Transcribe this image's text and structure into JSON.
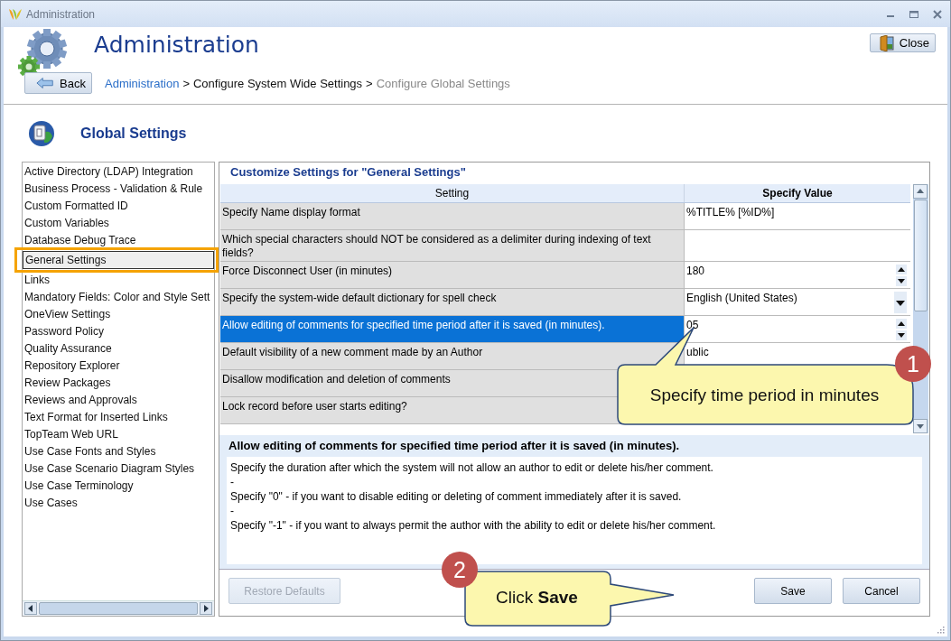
{
  "window": {
    "title": "Administration"
  },
  "header": {
    "title": "Administration",
    "close_button": "Close",
    "back_button": "Back",
    "breadcrumb": [
      {
        "label": "Administration",
        "kind": "link"
      },
      {
        "label": ">",
        "kind": "separator"
      },
      {
        "label": "Configure System Wide Settings",
        "kind": "current"
      },
      {
        "label": ">",
        "kind": "separator"
      },
      {
        "label": "Configure Global Settings",
        "kind": "muted"
      }
    ]
  },
  "section": {
    "title": "Global Settings"
  },
  "sidebar": {
    "items": [
      {
        "label": "Active Directory (LDAP) Integration",
        "selected": false
      },
      {
        "label": "Business Process - Validation & Rule",
        "selected": false
      },
      {
        "label": "Custom Formatted ID",
        "selected": false
      },
      {
        "label": "Custom Variables",
        "selected": false
      },
      {
        "label": "Database Debug Trace",
        "selected": false
      },
      {
        "label": "General Settings",
        "selected": true
      },
      {
        "label": "Links",
        "selected": false
      },
      {
        "label": "Mandatory Fields: Color and Style Sett",
        "selected": false
      },
      {
        "label": "OneView Settings",
        "selected": false
      },
      {
        "label": "Password Policy",
        "selected": false
      },
      {
        "label": "Quality Assurance",
        "selected": false
      },
      {
        "label": "Repository Explorer",
        "selected": false
      },
      {
        "label": "Review Packages",
        "selected": false
      },
      {
        "label": "Reviews and Approvals",
        "selected": false
      },
      {
        "label": "Text Format for Inserted Links",
        "selected": false
      },
      {
        "label": "TopTeam Web URL",
        "selected": false
      },
      {
        "label": "Use Case Fonts and Styles",
        "selected": false
      },
      {
        "label": "Use Case Scenario Diagram Styles",
        "selected": false
      },
      {
        "label": "Use Case Terminology",
        "selected": false
      },
      {
        "label": "Use Cases",
        "selected": false
      }
    ]
  },
  "settings": {
    "title": "Customize Settings for \"General Settings\"",
    "table": {
      "columns": [
        "Setting",
        "Specify Value"
      ],
      "rows": [
        {
          "setting": "Specify Name display format",
          "value": "%TITLE% [%ID%]",
          "kind": "text",
          "selected": false
        },
        {
          "setting": "Which special characters should NOT be considered as a delimiter during indexing of text fields?",
          "kind": "text",
          "selected": false
        },
        {
          "setting": "Force Disconnect User (in minutes)",
          "value": "180",
          "kind": "spinner",
          "selected": false
        },
        {
          "setting": "Specify the system-wide default dictionary for spell check",
          "value": "English (United States)",
          "kind": "dropdown",
          "selected": false
        },
        {
          "setting": "Allow editing of comments for specified time period after it is saved (in minutes).",
          "value": "05",
          "kind": "spinner",
          "selected": true
        },
        {
          "setting": "Default visibility of a new comment made by an Author",
          "value": "ublic",
          "kind": "text",
          "selected": false
        },
        {
          "setting": "Disallow modification and deletion of comments",
          "kind": "text",
          "selected": false
        },
        {
          "setting": "Lock record before user starts editing?",
          "kind": "text",
          "selected": false
        }
      ]
    },
    "description": {
      "title": "Allow editing of comments for specified time period after it is saved (in minutes).",
      "lines": [
        "Specify the duration after which the system will not allow an author to edit or delete his/her comment.",
        "-",
        "Specify \"0\" - if you want to disable editing or deleting of comment immediately after it is saved.",
        "-",
        "Specify \"-1\" - if you want to always permit the author with the ability to edit or delete his/her comment."
      ]
    },
    "buttons": [
      {
        "label": "Restore Defaults",
        "disabled": true
      },
      {
        "label": "Save",
        "disabled": false
      },
      {
        "label": "Cancel",
        "disabled": false
      }
    ]
  },
  "callouts": [
    {
      "number": "1",
      "text": "Specify time period in minutes"
    },
    {
      "number": "2",
      "text": "Click **Save**"
    }
  ]
}
